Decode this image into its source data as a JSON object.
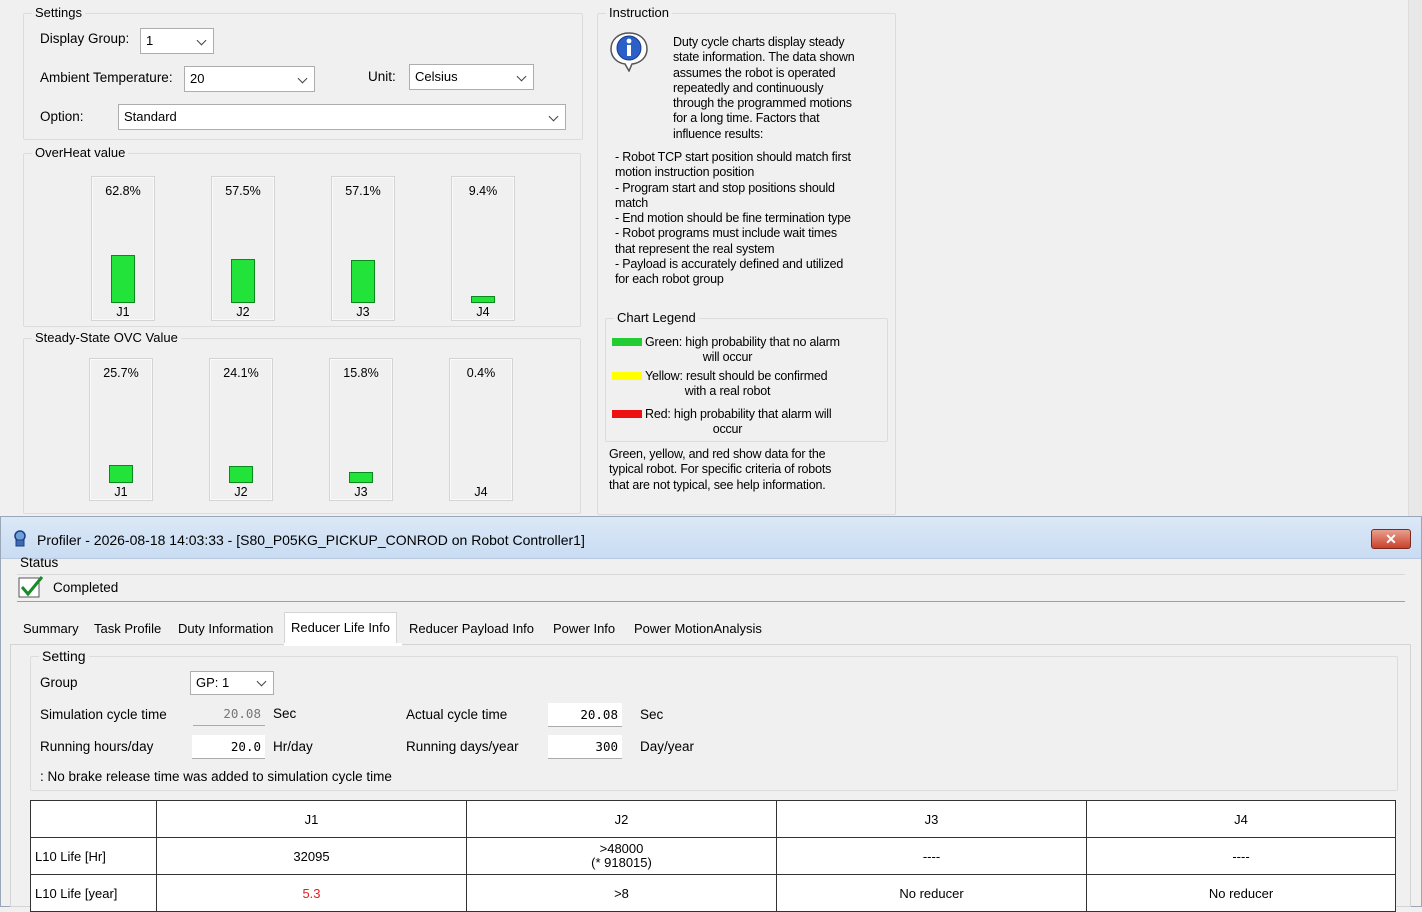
{
  "settings": {
    "title": "Settings",
    "display_group_label": "Display Group:",
    "display_group_value": "1",
    "ambient_label": "Ambient Temperature:",
    "ambient_value": "20",
    "unit_label": "Unit:",
    "unit_value": "Celsius",
    "option_label": "Option:",
    "option_value": "Standard"
  },
  "overheat": {
    "title": "OverHeat value",
    "bars": [
      {
        "joint": "J1",
        "label": "62.8%",
        "value": 62.8
      },
      {
        "joint": "J2",
        "label": "57.5%",
        "value": 57.5
      },
      {
        "joint": "J3",
        "label": "57.1%",
        "value": 57.1
      },
      {
        "joint": "J4",
        "label": "9.4%",
        "value": 9.4
      }
    ]
  },
  "ovc": {
    "title": "Steady-State OVC Value",
    "bars": [
      {
        "joint": "J1",
        "label": "25.7%",
        "value": 25.7
      },
      {
        "joint": "J2",
        "label": "24.1%",
        "value": 24.1
      },
      {
        "joint": "J3",
        "label": "15.8%",
        "value": 15.8
      },
      {
        "joint": "J4",
        "label": "0.4%",
        "value": 0.4
      }
    ]
  },
  "instruction": {
    "title": "Instruction",
    "intro": [
      "Duty cycle charts display steady",
      "state information. The data shown",
      "assumes the robot is operated",
      "repeatedly and continuously",
      "through the programmed motions",
      "for a long time. Factors that",
      "influence results:"
    ],
    "bullets": [
      "- Robot TCP start position should match first",
      "motion instruction position",
      "- Program start and stop positions should",
      "match",
      "- End motion should be fine termination type",
      "- Robot programs must include wait times",
      "that represent the real system",
      "- Payload is accurately defined and utilized",
      "for each robot group"
    ],
    "legend_title": "Chart Legend",
    "legend": [
      {
        "color": "#22cc33",
        "line1": "Green: high probability that no alarm",
        "line2": "will occur"
      },
      {
        "color": "#ffff00",
        "line1": "Yellow: result should be confirmed",
        "line2": "with a real robot"
      },
      {
        "color": "#ee1111",
        "line1": "Red: high probability that alarm will",
        "line2": "occur"
      }
    ],
    "footer": [
      "Green, yellow, and red show data for the",
      "typical robot. For specific criteria of robots",
      "that are not typical, see help information."
    ]
  },
  "profiler": {
    "title": "Profiler - 2026-08-18 14:03:33 - [S80_P05KG_PICKUP_CONROD on Robot Controller1]",
    "close": "✕",
    "status_title": "Status",
    "status_value": "Completed",
    "tabs": [
      "Summary",
      "Task Profile",
      "Duty Information",
      "Reducer Life Info",
      "Reducer Payload Info",
      "Power Info",
      "Power MotionAnalysis"
    ],
    "active_tab": "Reducer Life Info",
    "setting_title": "Setting",
    "group_label": "Group",
    "group_value": "GP: 1",
    "sim_cycle_label": "Simulation cycle time",
    "sim_cycle_value": "20.08",
    "sim_cycle_unit": "Sec",
    "actual_cycle_label": "Actual cycle time",
    "actual_cycle_value": "20.08",
    "actual_cycle_unit": "Sec",
    "hours_label": "Running hours/day",
    "hours_value": "20.0",
    "hours_unit": "Hr/day",
    "days_label": "Running days/year",
    "days_value": "300",
    "days_unit": "Day/year",
    "note": ": No brake release time was added to simulation cycle time",
    "table": {
      "headers": [
        "",
        "J1",
        "J2",
        "J3",
        "J4"
      ],
      "row1": {
        "label": "L10 Life [Hr]",
        "j1": "32095",
        "j2a": ">48000",
        "j2b": "(* 918015)",
        "j3": "----",
        "j4": "----"
      },
      "row2": {
        "label": "L10 Life [year]",
        "j1": "5.3",
        "j2": ">8",
        "j3": "No reducer",
        "j4": "No reducer"
      }
    }
  }
}
